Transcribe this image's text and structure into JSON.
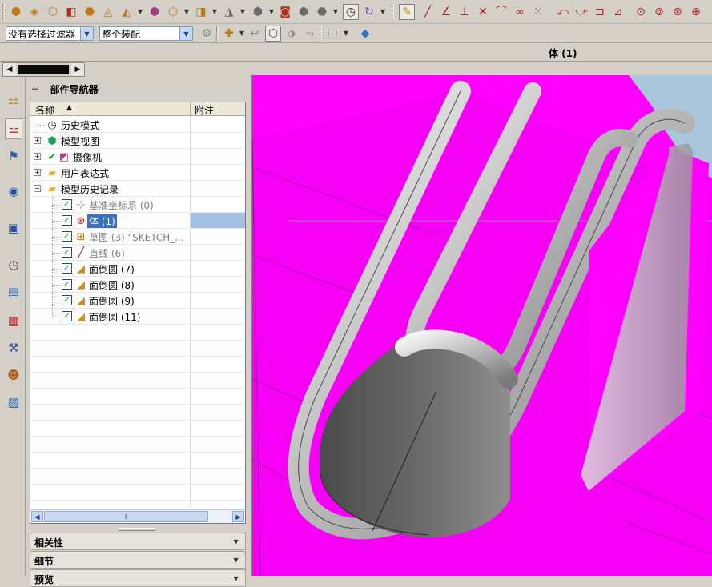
{
  "toolbar": {
    "selection_filter": "没有选择过滤器",
    "assembly_scope": "整个装配"
  },
  "title_strip": {
    "label": "体 (1)"
  },
  "navigator": {
    "title": "部件导航器",
    "columns": {
      "name": "名称",
      "notes": "附注"
    },
    "nodes": [
      {
        "label": "历史模式",
        "icon": "clock-icon"
      },
      {
        "label": "模型视图",
        "icon": "views-icon"
      },
      {
        "label": "摄像机",
        "icon": "camera-icon"
      },
      {
        "label": "用户表达式",
        "icon": "folder-icon"
      },
      {
        "label": "模型历史记录",
        "icon": "folder-open-icon"
      }
    ],
    "features": [
      {
        "label": "基准坐标系 (0)",
        "icon": "datum-csys-icon"
      },
      {
        "label": "体 (1)",
        "icon": "body-icon"
      },
      {
        "label": "草图 (3) \"SKETCH_...",
        "icon": "sketch-icon"
      },
      {
        "label": "直线 (6)",
        "icon": "line-icon"
      },
      {
        "label": "面倒圆 (7)",
        "icon": "face-blend-icon"
      },
      {
        "label": "面倒圆 (8)",
        "icon": "face-blend-icon"
      },
      {
        "label": "面倒圆 (9)",
        "icon": "face-blend-icon"
      },
      {
        "label": "面倒圆 (11)",
        "icon": "face-blend-icon"
      }
    ],
    "panels": [
      {
        "label": "相关性"
      },
      {
        "label": "细节"
      },
      {
        "label": "预览"
      }
    ]
  },
  "colors": {
    "viewport_magenta": "#ff00ff",
    "selection_blue": "#a3bee3",
    "chrome_gray": "#d4d0c8"
  }
}
